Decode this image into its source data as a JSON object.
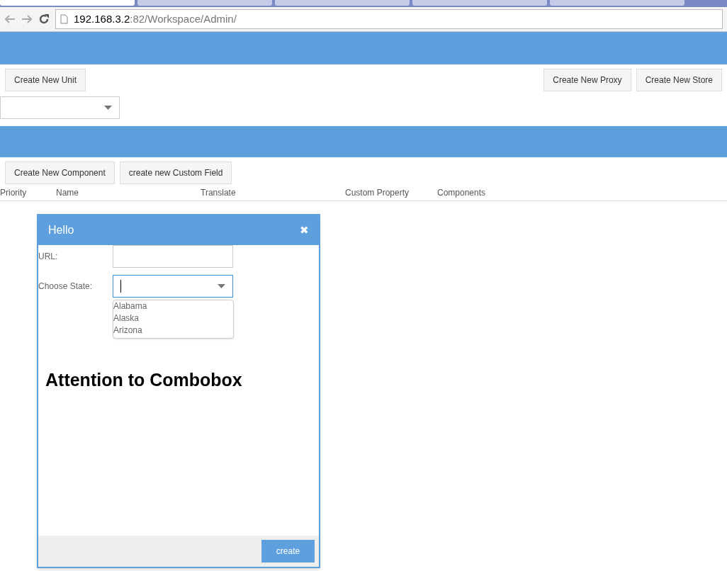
{
  "browser": {
    "tabs": [
      {
        "selected": true
      },
      {
        "selected": false
      },
      {
        "selected": false
      },
      {
        "selected": false
      },
      {
        "selected": false
      }
    ],
    "url_host": "192.168.3.2",
    "url_rest": ":82/Workspace/Admin/"
  },
  "toolbar_top": {
    "left_buttons": [
      "Create New Unit"
    ],
    "right_buttons": [
      "Create New Proxy",
      "Create New Store"
    ]
  },
  "toolbar_bottom": {
    "buttons": [
      "Create New Component",
      "create new Custom Field"
    ]
  },
  "table": {
    "columns": [
      "Priority",
      "Name",
      "Translate",
      "Custom Property",
      "Components"
    ]
  },
  "dialog": {
    "title": "Hello",
    "close": "✖",
    "fields": [
      {
        "kind": "text",
        "label": "URL:"
      },
      {
        "kind": "combo",
        "label": "Choose State:",
        "focused": true,
        "options": [
          "Alabama",
          "Alaska",
          "Arizona"
        ]
      }
    ],
    "heading": "Attention to Combobox",
    "button": "create"
  }
}
